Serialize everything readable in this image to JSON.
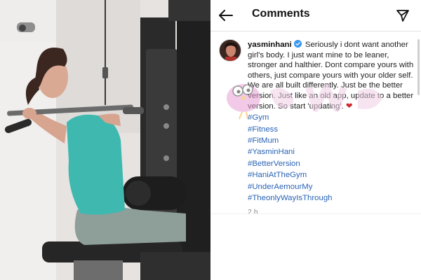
{
  "header": {
    "title": "Comments",
    "back_icon": "arrow-left-icon",
    "share_icon": "paper-plane-icon"
  },
  "comment": {
    "username": "yasminhani",
    "verified_icon": "verified-badge-icon",
    "text": "Seriously i dont want another girl's body. I just want mine to be leaner, stronger and halthier. Dont compare yours with others, just compare yours with your older self. We  are all built differently. Just be the better version. Just like an old app, update to a better version. So start 'updating'.",
    "emoji": "❤",
    "hashtags": [
      "#Gym",
      "#Fitness",
      "#FitMum",
      "#YasminHani",
      "#BetterVersion",
      "#HaniAtTheGym",
      "#UnderAemourMy",
      "#TheonlyWayIsThrough"
    ],
    "time": "2 h"
  },
  "colors": {
    "link": "#2a63b5",
    "verified": "#3897f0",
    "heart": "#d0262d",
    "shirt": "#3fb8b0"
  }
}
